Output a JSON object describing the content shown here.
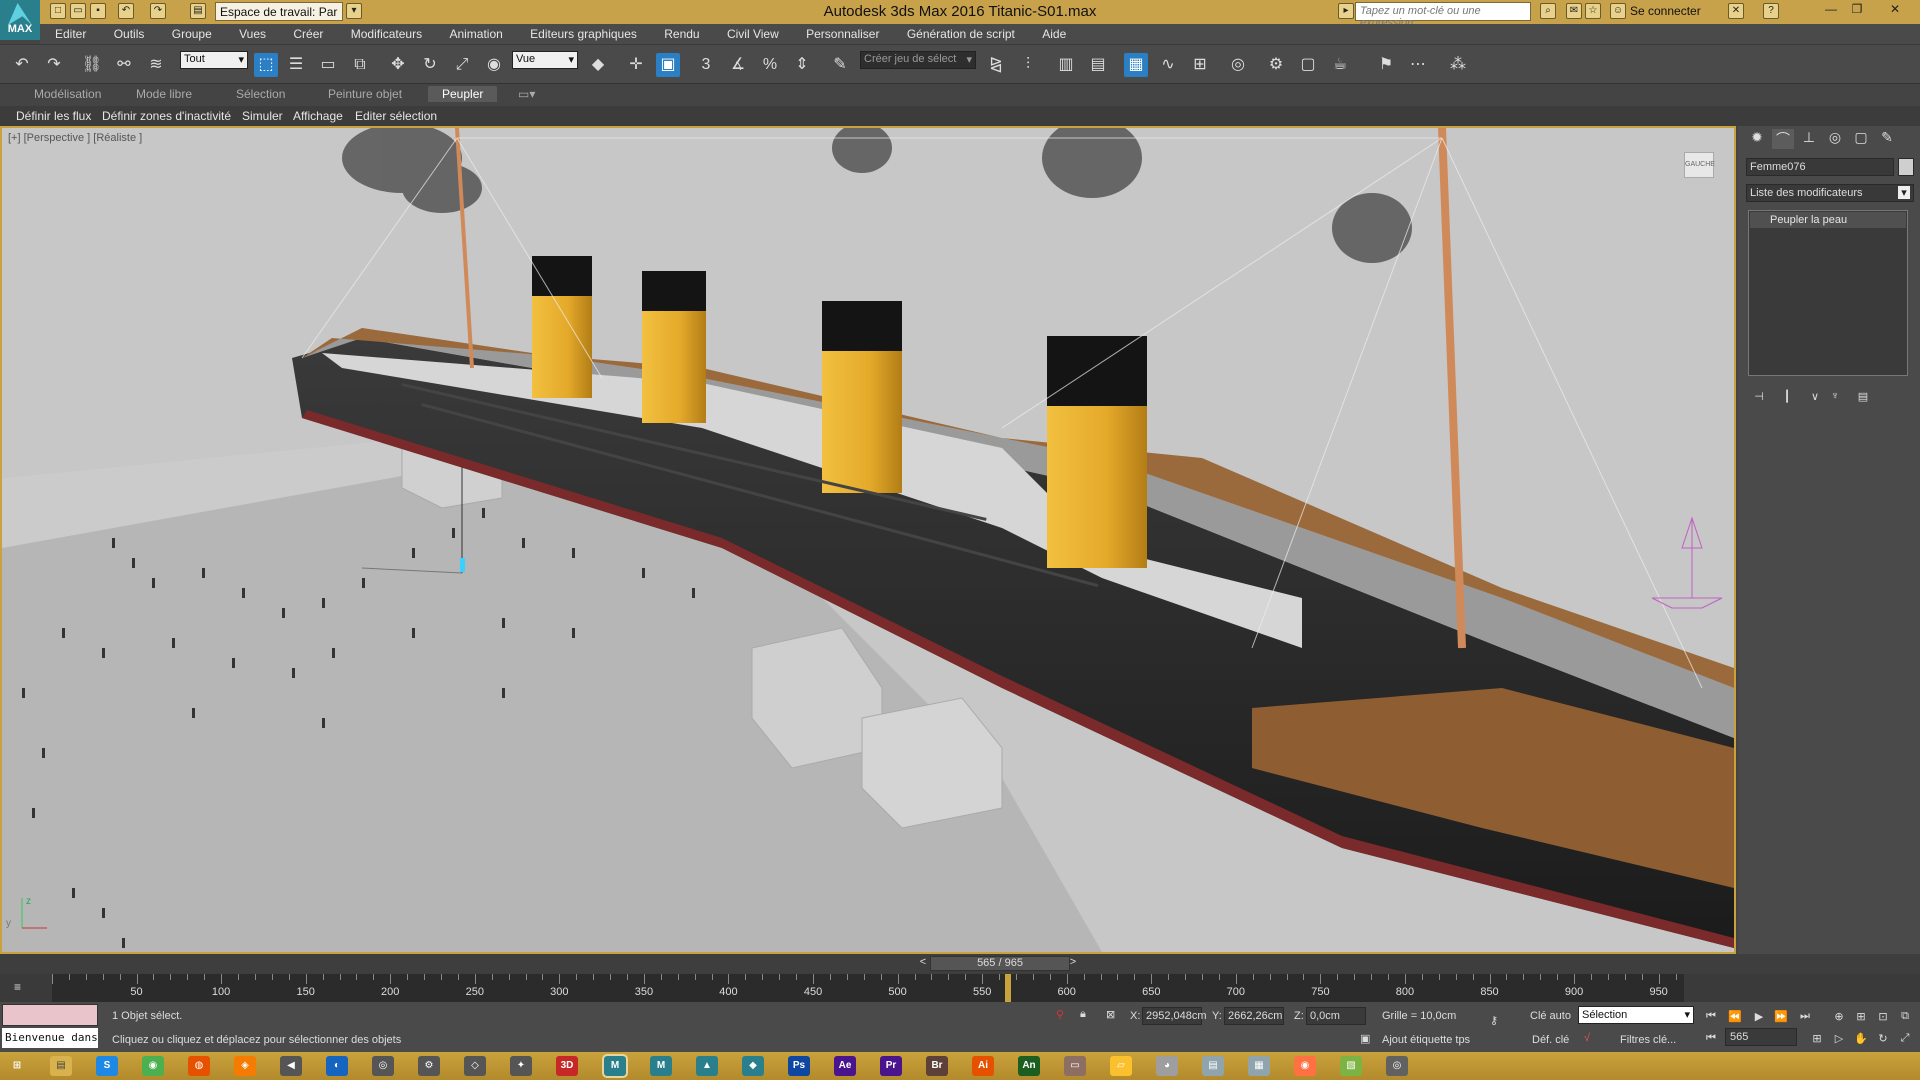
{
  "app": {
    "logo_text": "MAX",
    "title": "Autodesk 3ds Max 2016     Titanic-S01.max",
    "workspace_label": "Espace de travail: Par",
    "search_placeholder": "Tapez un mot-clé ou une expression",
    "connect_label": "Se connecter"
  },
  "menu": [
    "Editer",
    "Outils",
    "Groupe",
    "Vues",
    "Créer",
    "Modificateurs",
    "Animation",
    "Editeurs graphiques",
    "Rendu",
    "Civil View",
    "Personnaliser",
    "Génération de script",
    "Aide"
  ],
  "toolbar": {
    "filter_value": "Tout",
    "refcoord_value": "Vue",
    "selection_set_placeholder": "Créer jeu de sélect"
  },
  "ribbon": {
    "tabs": [
      "Modélisation",
      "Mode libre",
      "Sélection",
      "Peinture objet",
      "Peupler"
    ],
    "active_tab": "Peupler",
    "sub_items": [
      "Définir les flux",
      "Définir zones d'inactivité",
      "Simuler",
      "Affichage",
      "Editer sélection"
    ]
  },
  "viewport": {
    "label": "[+] [Perspective ] [Réaliste ]",
    "viewcube_label": "GAUCHE"
  },
  "command_panel": {
    "object_name": "Femme076",
    "modifier_list": "Liste des modificateurs",
    "stack_item": "Peupler la peau"
  },
  "timeline": {
    "frame_display": "565 / 965",
    "ticks": [
      50,
      100,
      150,
      200,
      250,
      300,
      350,
      400,
      450,
      500,
      550,
      600,
      650,
      700,
      750,
      800,
      850,
      900,
      950
    ],
    "current_frame": 565,
    "total_frames": 965
  },
  "status": {
    "welcome": "Bienvenue dans",
    "selected": "1 Objet sélect.",
    "prompt": "Cliquez ou cliquez et déplacez pour sélectionner des objets",
    "x_label": "X:",
    "x_value": "2952,048cm",
    "y_label": "Y:",
    "y_value": "2662,26cm",
    "z_label": "Z:",
    "z_value": "0,0cm",
    "grid": "Grille = 10,0cm",
    "autokey": "Clé auto",
    "selection_mode": "Sélection",
    "setkey": "Déf. clé",
    "key_filters": "Filtres clé...",
    "add_time_tag": "Ajout étiquette tps",
    "frame_value": "565"
  },
  "colors": {
    "accent": "#c9a23c",
    "active_blue": "#2b7fc4",
    "funnel": "#e4a92a"
  }
}
